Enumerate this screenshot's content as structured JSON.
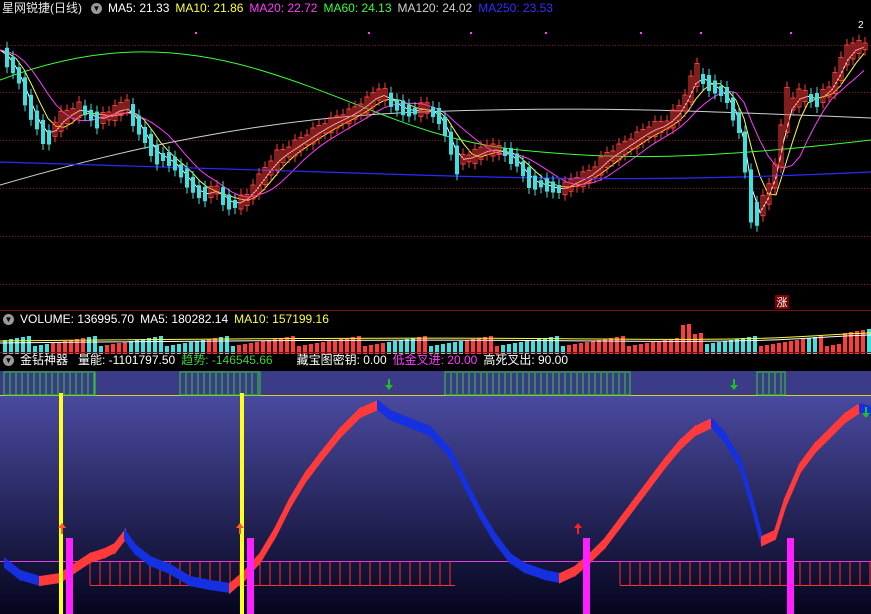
{
  "colors": {
    "ma5": "#ffffff",
    "ma10": "#ffff3c",
    "ma20": "#ff3cff",
    "ma60": "#3cff3c",
    "ma120": "#d0d0d0",
    "ma250": "#2a2aff",
    "up": "#ff3c3c",
    "down": "#40e0e0",
    "grid": "#8a1010",
    "buy_arrow": "#ff2020",
    "sell_arrow": "#20c020",
    "curve_up": "#ff3a3a",
    "curve_down": "#1530e0"
  },
  "price_panel": {
    "title": "星网锐捷(日线)",
    "ma5": "MA5: 21.33",
    "ma10": "MA10: 21.86",
    "ma20": "MA20: 22.72",
    "ma60": "MA60: 24.13",
    "ma120": "MA120: 24.02",
    "ma250": "MA250: 23.53",
    "tag_zhang": "涨",
    "corner_label": "2"
  },
  "volume_panel": {
    "volume": "VOLUME: 136995.70",
    "ma5": "MA5: 180282.14",
    "ma10": "MA10: 157199.16"
  },
  "indicator_panel": {
    "name": "金钻神器",
    "liangneng": "量能: -1101797.50",
    "qushi": "趋势: -146545.66",
    "mijue": "藏宝图密钥: 0.00",
    "dijin": "低金叉进: 20.00",
    "gaosi": "高死叉出: 90.00"
  },
  "icons": [
    "collapse-icon",
    "up-arrow-icon",
    "down-arrow-icon"
  ]
}
